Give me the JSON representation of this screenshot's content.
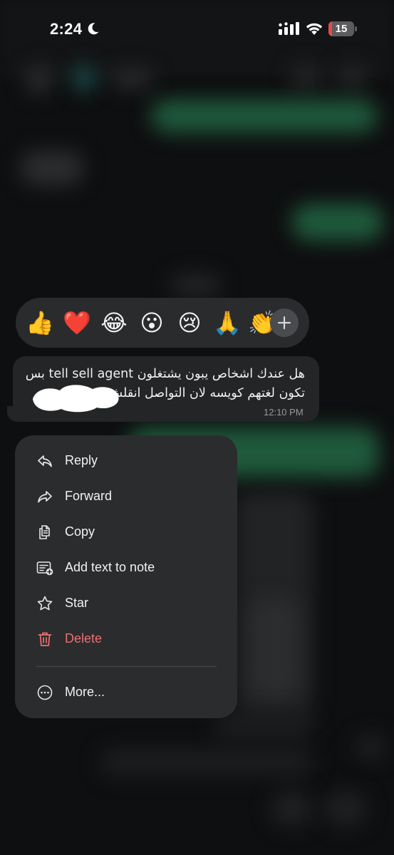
{
  "status_bar": {
    "time": "2:24",
    "battery_level": "15",
    "battery_fraction": 0.15
  },
  "reactions": {
    "emojis": [
      {
        "name": "thumbs-up-emoji",
        "glyph": "👍"
      },
      {
        "name": "red-heart-emoji",
        "glyph": "❤️"
      },
      {
        "name": "tears-of-joy-emoji",
        "glyph": "😂"
      },
      {
        "name": "surprised-face-emoji",
        "glyph": "😮"
      },
      {
        "name": "crying-face-emoji",
        "glyph": "😢"
      },
      {
        "name": "folded-hands-emoji",
        "glyph": "🙏"
      },
      {
        "name": "clapping-hands-emoji",
        "glyph": "👏"
      }
    ]
  },
  "message": {
    "line1": "هل عندك اشخاص يبون يشتغلون tell sell agent بس",
    "line2": "تكون لغتهم كويسه لان التواصل انقلش",
    "time": "12:10 PM"
  },
  "menu": {
    "reply": "Reply",
    "forward": "Forward",
    "copy": "Copy",
    "add_note": "Add text to note",
    "star": "Star",
    "delete": "Delete",
    "more": "More..."
  },
  "colors": {
    "background": "#0e0f10",
    "menu_bg": "#2b2c2e",
    "bubble_bg": "#242526",
    "delete_red": "#ee6f72",
    "blurred_green": "#1f5a3c"
  }
}
